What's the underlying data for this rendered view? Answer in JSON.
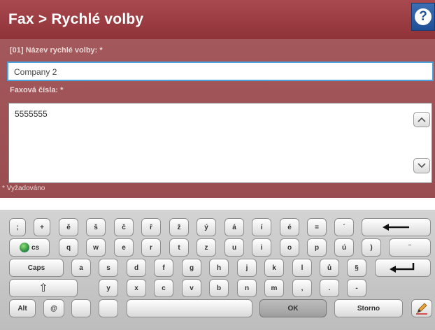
{
  "header": {
    "title": "Fax > Rychlé volby",
    "help_glyph": "?"
  },
  "form": {
    "name_label": "[01] Název rychlé volby: *",
    "name_value": "Company 2",
    "numbers_label": "Faxová čísla: *",
    "numbers_value": "5555555",
    "required_note": "* Vyžadováno"
  },
  "keyboard": {
    "row1": [
      ";",
      "+",
      "ě",
      "š",
      "č",
      "ř",
      "ž",
      "ý",
      "á",
      "í",
      "é",
      "=",
      "´"
    ],
    "row2_lang": "cs",
    "row2": [
      "q",
      "w",
      "e",
      "r",
      "t",
      "z",
      "u",
      "i",
      "o",
      "p",
      "ú",
      ")",
      "¨"
    ],
    "caps_label": "Caps",
    "row3": [
      "a",
      "s",
      "d",
      "f",
      "g",
      "h",
      "j",
      "k",
      "l",
      "ů",
      "§"
    ],
    "shift_glyph": "⇧",
    "row4": [
      "y",
      "x",
      "c",
      "v",
      "b",
      "n",
      "m",
      ",",
      ".",
      "-"
    ],
    "alt_label": "Alt",
    "at_label": "@",
    "ok_label": "OK",
    "cancel_label": "Storno"
  },
  "icons": {
    "help": "help-icon",
    "backspace": "backspace-arrow-icon",
    "enter": "enter-arrow-icon",
    "shift": "shift-arrow-icon",
    "language": "globe-icon",
    "edit": "pencil-icon"
  },
  "colors": {
    "header": "#9a3d42",
    "panel": "#9e5154",
    "focus": "#4aa3df"
  }
}
